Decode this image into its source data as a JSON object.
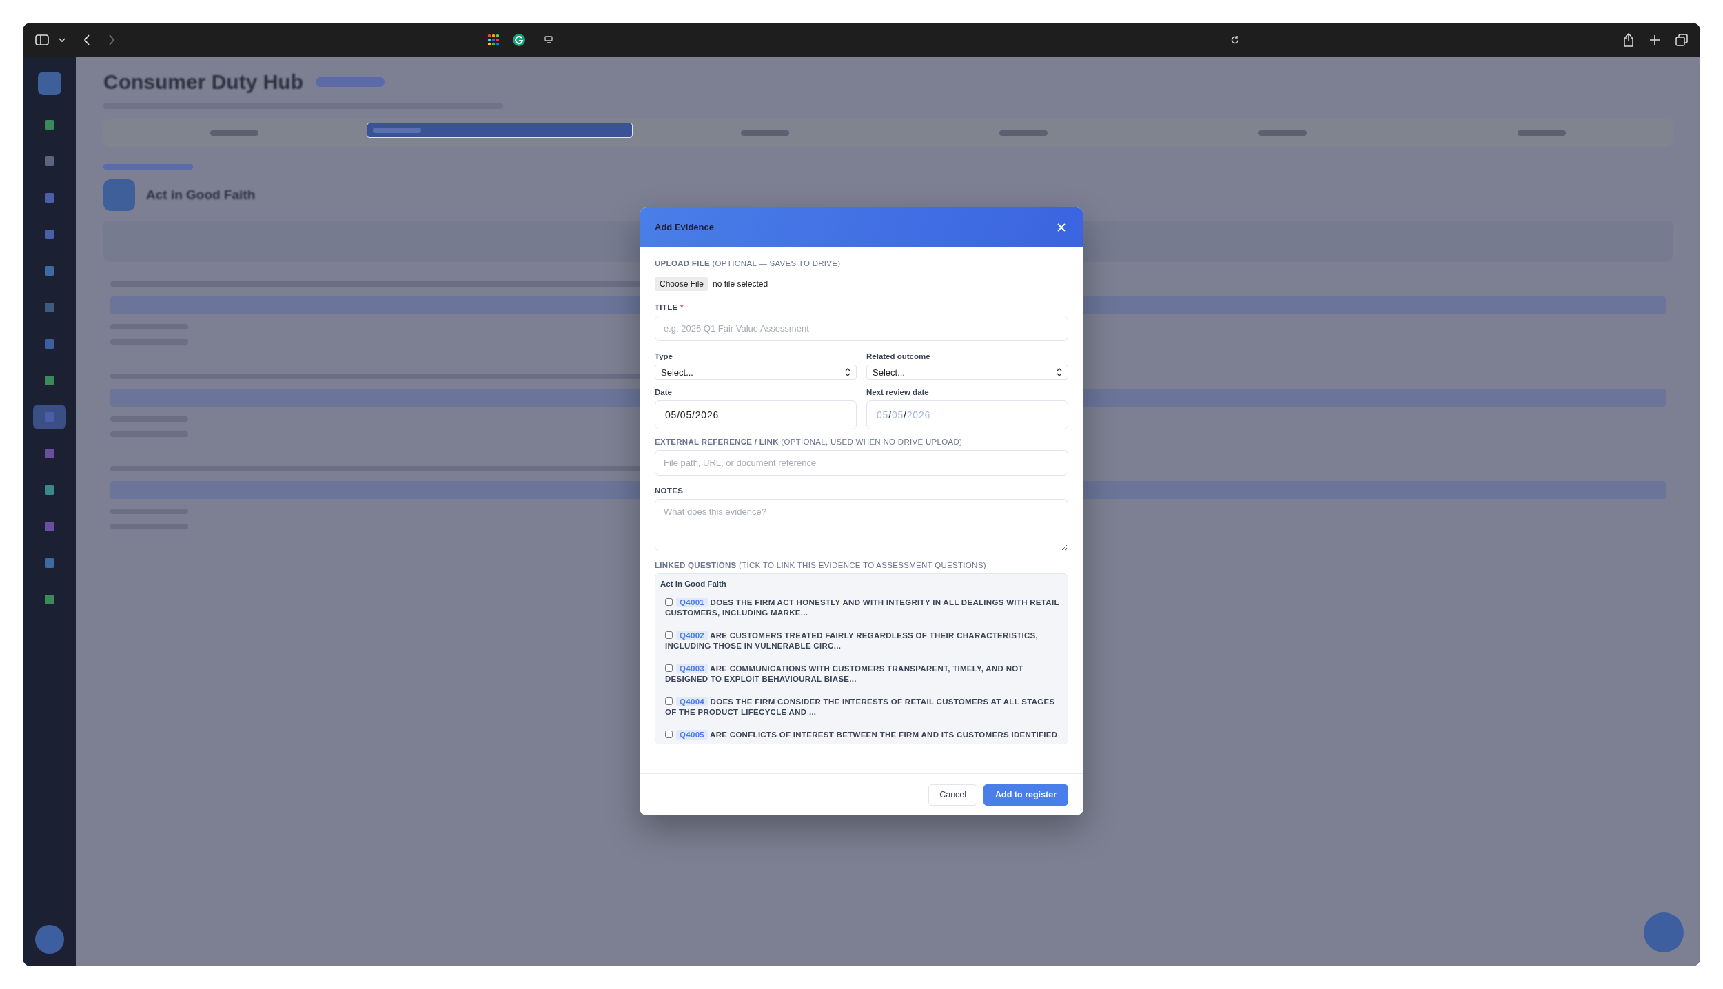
{
  "background": {
    "app_title": "Consumer Duty Hub",
    "section_title": "Act in Good Faith",
    "sidebar_items": [
      {
        "selected": false
      },
      {
        "selected": false
      },
      {
        "selected": false
      },
      {
        "selected": false
      },
      {
        "selected": false
      },
      {
        "selected": false
      },
      {
        "selected": false
      },
      {
        "selected": false
      },
      {
        "selected": true
      },
      {
        "selected": false
      },
      {
        "selected": false
      },
      {
        "selected": false
      },
      {
        "selected": false
      },
      {
        "selected": false
      }
    ],
    "tabs": [
      {
        "selected": false
      },
      {
        "selected": true
      },
      {
        "selected": false
      },
      {
        "selected": false
      },
      {
        "selected": false
      },
      {
        "selected": false
      }
    ]
  },
  "modal": {
    "title": "Add Evidence",
    "upload": {
      "label": "**UPLOAD FILE** (OPTIONAL — SAVES TO DRIVE)",
      "button": "Choose File",
      "status": "no file selected"
    },
    "title_field": {
      "label": "TITLE",
      "required_mark": "*",
      "placeholder": "e.g. 2026 Q1 Fair Value Assessment"
    },
    "type_field": {
      "label": "Type",
      "value": "Select..."
    },
    "outcome_field": {
      "label": "Related outcome",
      "value": "Select..."
    },
    "date_field": {
      "label": "Date",
      "value": "05/05/2026"
    },
    "next_review_field": {
      "label": "Next review date",
      "placeholder": "05/05/2026"
    },
    "reference_field": {
      "label": "**EXTERNAL REFERENCE / LINK** (OPTIONAL, USED WHEN NO DRIVE UPLOAD)",
      "placeholder": "File path, URL, or document reference"
    },
    "notes_field": {
      "label": "NOTES",
      "placeholder": "What does this evidence?"
    },
    "linked_questions": {
      "label": "**LINKED QUESTIONS** (TICK TO LINK THIS EVIDENCE TO ASSESSMENT QUESTIONS)",
      "group": "Act in Good Faith",
      "questions": [
        {
          "code": "Q4001",
          "text": "DOES THE FIRM ACT HONESTLY AND WITH INTEGRITY IN ALL DEALINGS WITH RETAIL CUSTOMERS, INCLUDING MARKE...",
          "checked": false
        },
        {
          "code": "Q4002",
          "text": "ARE CUSTOMERS TREATED FAIRLY REGARDLESS OF THEIR CHARACTERISTICS, INCLUDING THOSE IN VULNERABLE CIRC...",
          "checked": false
        },
        {
          "code": "Q4003",
          "text": "ARE COMMUNICATIONS WITH CUSTOMERS TRANSPARENT, TIMELY, AND NOT DESIGNED TO EXPLOIT BEHAVIOURAL BIASE...",
          "checked": false
        },
        {
          "code": "Q4004",
          "text": "DOES THE FIRM CONSIDER THE INTERESTS OF RETAIL CUSTOMERS AT ALL STAGES OF THE PRODUCT LIFECYCLE AND ...",
          "checked": false
        },
        {
          "code": "Q4005",
          "text": "ARE CONFLICTS OF INTEREST BETWEEN THE FIRM AND ITS CUSTOMERS IDENTIFIED",
          "checked": false
        }
      ]
    },
    "buttons": [
      {
        "label": "Cancel",
        "kind": "secondary"
      },
      {
        "label": "Add to register",
        "kind": "primary"
      }
    ]
  }
}
